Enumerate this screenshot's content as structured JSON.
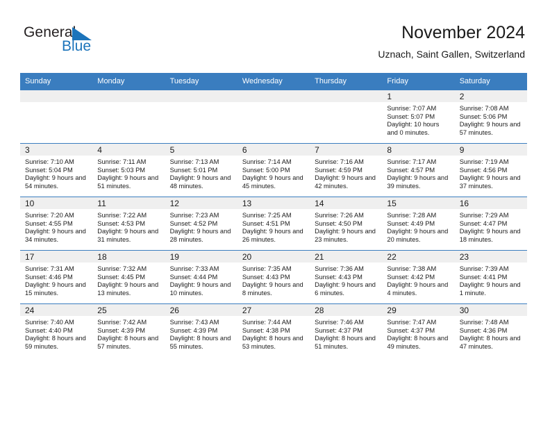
{
  "brand": {
    "name_part1": "General",
    "name_part2": "Blue",
    "triangle_color": "#1c74bb",
    "text_color": "#231f20"
  },
  "header": {
    "title": "November 2024",
    "subtitle": "Uznach, Saint Gallen, Switzerland"
  },
  "theme": {
    "header_bg": "#3a7dbf",
    "header_text": "#ffffff",
    "daynum_band_bg": "#efefef",
    "row_divider": "#3a7dbf",
    "body_text": "#1a1a1a"
  },
  "weekday_headers": [
    "Sunday",
    "Monday",
    "Tuesday",
    "Wednesday",
    "Thursday",
    "Friday",
    "Saturday"
  ],
  "weeks": [
    [
      {
        "day": "",
        "empty": true
      },
      {
        "day": "",
        "empty": true
      },
      {
        "day": "",
        "empty": true
      },
      {
        "day": "",
        "empty": true
      },
      {
        "day": "",
        "empty": true
      },
      {
        "day": "1",
        "sunrise": "Sunrise: 7:07 AM",
        "sunset": "Sunset: 5:07 PM",
        "daylight": "Daylight: 10 hours and 0 minutes."
      },
      {
        "day": "2",
        "sunrise": "Sunrise: 7:08 AM",
        "sunset": "Sunset: 5:06 PM",
        "daylight": "Daylight: 9 hours and 57 minutes."
      }
    ],
    [
      {
        "day": "3",
        "sunrise": "Sunrise: 7:10 AM",
        "sunset": "Sunset: 5:04 PM",
        "daylight": "Daylight: 9 hours and 54 minutes."
      },
      {
        "day": "4",
        "sunrise": "Sunrise: 7:11 AM",
        "sunset": "Sunset: 5:03 PM",
        "daylight": "Daylight: 9 hours and 51 minutes."
      },
      {
        "day": "5",
        "sunrise": "Sunrise: 7:13 AM",
        "sunset": "Sunset: 5:01 PM",
        "daylight": "Daylight: 9 hours and 48 minutes."
      },
      {
        "day": "6",
        "sunrise": "Sunrise: 7:14 AM",
        "sunset": "Sunset: 5:00 PM",
        "daylight": "Daylight: 9 hours and 45 minutes."
      },
      {
        "day": "7",
        "sunrise": "Sunrise: 7:16 AM",
        "sunset": "Sunset: 4:59 PM",
        "daylight": "Daylight: 9 hours and 42 minutes."
      },
      {
        "day": "8",
        "sunrise": "Sunrise: 7:17 AM",
        "sunset": "Sunset: 4:57 PM",
        "daylight": "Daylight: 9 hours and 39 minutes."
      },
      {
        "day": "9",
        "sunrise": "Sunrise: 7:19 AM",
        "sunset": "Sunset: 4:56 PM",
        "daylight": "Daylight: 9 hours and 37 minutes."
      }
    ],
    [
      {
        "day": "10",
        "sunrise": "Sunrise: 7:20 AM",
        "sunset": "Sunset: 4:55 PM",
        "daylight": "Daylight: 9 hours and 34 minutes."
      },
      {
        "day": "11",
        "sunrise": "Sunrise: 7:22 AM",
        "sunset": "Sunset: 4:53 PM",
        "daylight": "Daylight: 9 hours and 31 minutes."
      },
      {
        "day": "12",
        "sunrise": "Sunrise: 7:23 AM",
        "sunset": "Sunset: 4:52 PM",
        "daylight": "Daylight: 9 hours and 28 minutes."
      },
      {
        "day": "13",
        "sunrise": "Sunrise: 7:25 AM",
        "sunset": "Sunset: 4:51 PM",
        "daylight": "Daylight: 9 hours and 26 minutes."
      },
      {
        "day": "14",
        "sunrise": "Sunrise: 7:26 AM",
        "sunset": "Sunset: 4:50 PM",
        "daylight": "Daylight: 9 hours and 23 minutes."
      },
      {
        "day": "15",
        "sunrise": "Sunrise: 7:28 AM",
        "sunset": "Sunset: 4:49 PM",
        "daylight": "Daylight: 9 hours and 20 minutes."
      },
      {
        "day": "16",
        "sunrise": "Sunrise: 7:29 AM",
        "sunset": "Sunset: 4:47 PM",
        "daylight": "Daylight: 9 hours and 18 minutes."
      }
    ],
    [
      {
        "day": "17",
        "sunrise": "Sunrise: 7:31 AM",
        "sunset": "Sunset: 4:46 PM",
        "daylight": "Daylight: 9 hours and 15 minutes."
      },
      {
        "day": "18",
        "sunrise": "Sunrise: 7:32 AM",
        "sunset": "Sunset: 4:45 PM",
        "daylight": "Daylight: 9 hours and 13 minutes."
      },
      {
        "day": "19",
        "sunrise": "Sunrise: 7:33 AM",
        "sunset": "Sunset: 4:44 PM",
        "daylight": "Daylight: 9 hours and 10 minutes."
      },
      {
        "day": "20",
        "sunrise": "Sunrise: 7:35 AM",
        "sunset": "Sunset: 4:43 PM",
        "daylight": "Daylight: 9 hours and 8 minutes."
      },
      {
        "day": "21",
        "sunrise": "Sunrise: 7:36 AM",
        "sunset": "Sunset: 4:43 PM",
        "daylight": "Daylight: 9 hours and 6 minutes."
      },
      {
        "day": "22",
        "sunrise": "Sunrise: 7:38 AM",
        "sunset": "Sunset: 4:42 PM",
        "daylight": "Daylight: 9 hours and 4 minutes."
      },
      {
        "day": "23",
        "sunrise": "Sunrise: 7:39 AM",
        "sunset": "Sunset: 4:41 PM",
        "daylight": "Daylight: 9 hours and 1 minute."
      }
    ],
    [
      {
        "day": "24",
        "sunrise": "Sunrise: 7:40 AM",
        "sunset": "Sunset: 4:40 PM",
        "daylight": "Daylight: 8 hours and 59 minutes."
      },
      {
        "day": "25",
        "sunrise": "Sunrise: 7:42 AM",
        "sunset": "Sunset: 4:39 PM",
        "daylight": "Daylight: 8 hours and 57 minutes."
      },
      {
        "day": "26",
        "sunrise": "Sunrise: 7:43 AM",
        "sunset": "Sunset: 4:39 PM",
        "daylight": "Daylight: 8 hours and 55 minutes."
      },
      {
        "day": "27",
        "sunrise": "Sunrise: 7:44 AM",
        "sunset": "Sunset: 4:38 PM",
        "daylight": "Daylight: 8 hours and 53 minutes."
      },
      {
        "day": "28",
        "sunrise": "Sunrise: 7:46 AM",
        "sunset": "Sunset: 4:37 PM",
        "daylight": "Daylight: 8 hours and 51 minutes."
      },
      {
        "day": "29",
        "sunrise": "Sunrise: 7:47 AM",
        "sunset": "Sunset: 4:37 PM",
        "daylight": "Daylight: 8 hours and 49 minutes."
      },
      {
        "day": "30",
        "sunrise": "Sunrise: 7:48 AM",
        "sunset": "Sunset: 4:36 PM",
        "daylight": "Daylight: 8 hours and 47 minutes."
      }
    ]
  ]
}
